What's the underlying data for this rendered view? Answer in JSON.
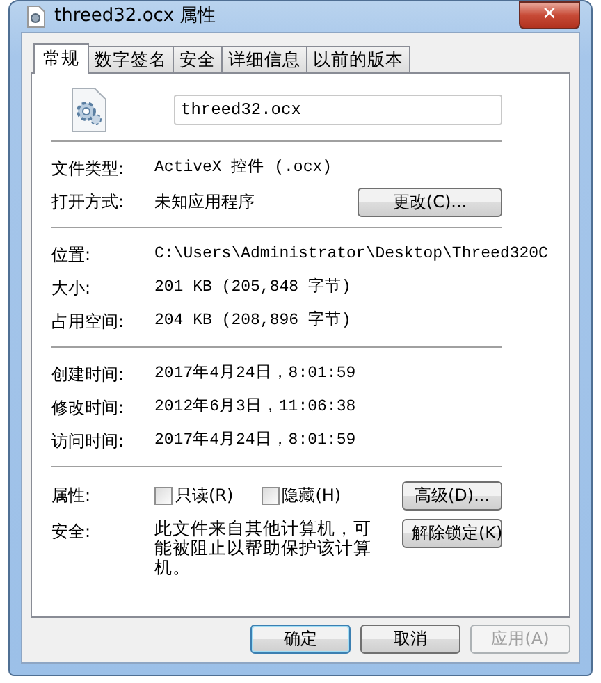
{
  "window": {
    "title": "threed32.ocx 属性",
    "close": "✕"
  },
  "tabs": [
    {
      "label": "常规",
      "selected": true
    },
    {
      "label": "数字签名",
      "selected": false
    },
    {
      "label": "安全",
      "selected": false
    },
    {
      "label": "详细信息",
      "selected": false
    },
    {
      "label": "以前的版本",
      "selected": false
    }
  ],
  "file": {
    "name": "threed32.ocx"
  },
  "sections": [
    {
      "rows": [
        {
          "label": "文件类型:",
          "value": "ActiveX 控件 (.ocx)"
        },
        {
          "label": "打开方式:",
          "value": "未知应用程序",
          "button": "更改(C)..."
        }
      ]
    },
    {
      "rows": [
        {
          "label": "位置:",
          "value": "C:\\Users\\Administrator\\Desktop\\Threed320C"
        },
        {
          "label": "大小:",
          "value": "201 KB (205,848 字节)"
        },
        {
          "label": "占用空间:",
          "value": "204 KB (208,896 字节)"
        }
      ]
    },
    {
      "rows": [
        {
          "label": "创建时间:",
          "value": "2017年4月24日，8:01:59"
        },
        {
          "label": "修改时间:",
          "value": "2012年6月3日，11:06:38"
        },
        {
          "label": "访问时间:",
          "value": "2017年4月24日，8:01:59"
        }
      ]
    }
  ],
  "attributes": {
    "label": "属性:",
    "checkboxes": [
      {
        "label": "只读(R)",
        "checked": false
      },
      {
        "label": "隐藏(H)",
        "checked": false
      }
    ],
    "button": "高级(D)..."
  },
  "security": {
    "label": "安全:",
    "text": "此文件来自其他计算机，可能被阻止以帮助保护该计算机。",
    "button": "解除锁定(K)"
  },
  "buttons": [
    {
      "label": "确定",
      "default": true,
      "disabled": false
    },
    {
      "label": "取消",
      "default": false,
      "disabled": false
    },
    {
      "label": "应用(A)",
      "default": false,
      "disabled": true
    }
  ]
}
